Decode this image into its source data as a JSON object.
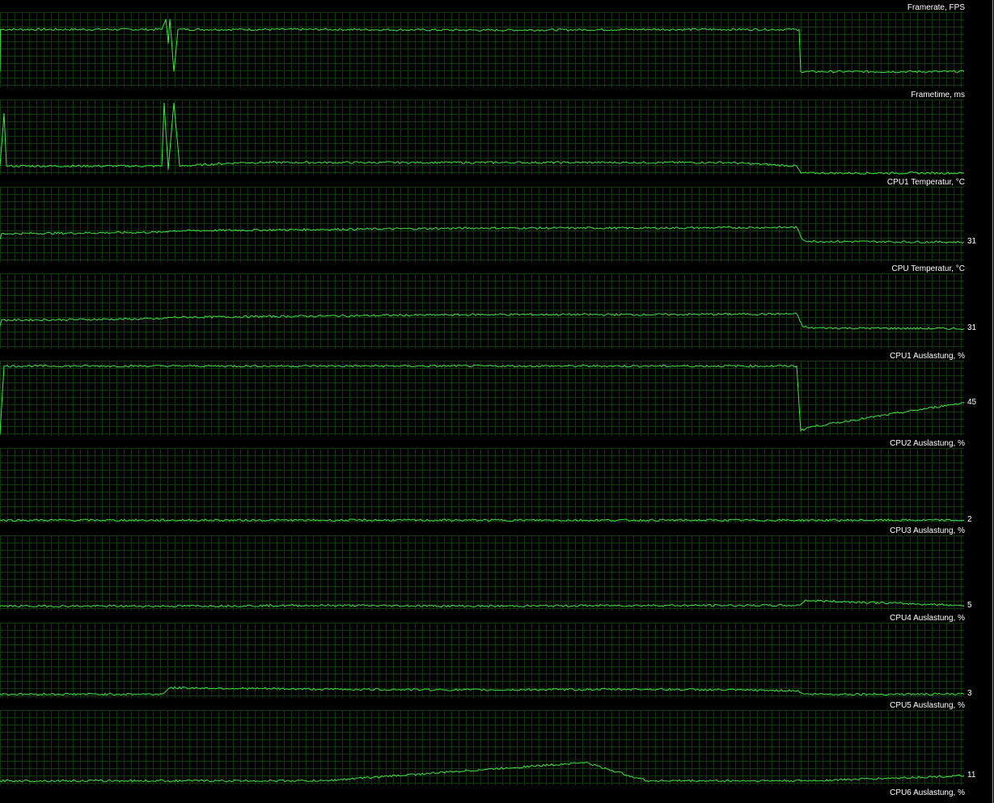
{
  "colors": {
    "background": "#000000",
    "grid": "#0d3a0d",
    "trace": "#3ee83e",
    "text": "#ffffff"
  },
  "chart_data": [
    {
      "type": "line",
      "title": "Framerate, FPS",
      "current_value": "",
      "ylim": [
        0,
        100
      ],
      "series": [
        {
          "points": [
            [
              0,
              20
            ],
            [
              0.5,
              80
            ],
            [
              200,
              80
            ],
            [
              205,
              95
            ],
            [
              208,
              60
            ],
            [
              210,
              95
            ],
            [
              215,
              20
            ],
            [
              220,
              80
            ],
            [
              400,
              80
            ],
            [
              600,
              79
            ],
            [
              800,
              80
            ],
            [
              988,
              80
            ],
            [
              990,
              20
            ],
            [
              1192,
              20
            ]
          ]
        }
      ]
    },
    {
      "type": "line",
      "title": "Frametime, ms",
      "current_value": "",
      "ylim": [
        0,
        100
      ],
      "series": [
        {
          "points": [
            [
              0,
              10
            ],
            [
              5,
              85
            ],
            [
              8,
              10
            ],
            [
              200,
              10
            ],
            [
              203,
              100
            ],
            [
              208,
              5
            ],
            [
              215,
              100
            ],
            [
              222,
              10
            ],
            [
              300,
              15
            ],
            [
              500,
              15
            ],
            [
              700,
              15
            ],
            [
              900,
              15
            ],
            [
              985,
              10
            ],
            [
              990,
              0
            ],
            [
              1192,
              0
            ]
          ]
        }
      ]
    },
    {
      "type": "line",
      "title": "CPU1 Temperatur, °C",
      "current_value": "31",
      "ylim": [
        0,
        100
      ],
      "series": [
        {
          "points": [
            [
              0,
              30
            ],
            [
              2,
              38
            ],
            [
              200,
              40
            ],
            [
              210,
              42
            ],
            [
              400,
              44
            ],
            [
              600,
              46
            ],
            [
              800,
              46
            ],
            [
              985,
              47
            ],
            [
              992,
              30
            ],
            [
              1000,
              27
            ],
            [
              1192,
              26
            ]
          ]
        }
      ]
    },
    {
      "type": "line",
      "title": "CPU Temperatur, °C",
      "current_value": "31",
      "ylim": [
        0,
        100
      ],
      "series": [
        {
          "points": [
            [
              0,
              30
            ],
            [
              2,
              38
            ],
            [
              200,
              40
            ],
            [
              210,
              42
            ],
            [
              400,
              44
            ],
            [
              600,
              46
            ],
            [
              800,
              46
            ],
            [
              985,
              47
            ],
            [
              992,
              30
            ],
            [
              1000,
              27
            ],
            [
              1192,
              26
            ]
          ]
        }
      ]
    },
    {
      "type": "line",
      "title": "CPU1 Auslastung, %",
      "current_value": "45",
      "ylim": [
        0,
        100
      ],
      "series": [
        {
          "points": [
            [
              0,
              0
            ],
            [
              5,
              97
            ],
            [
              220,
              97
            ],
            [
              400,
              97
            ],
            [
              600,
              97
            ],
            [
              800,
              97
            ],
            [
              985,
              97
            ],
            [
              990,
              5
            ],
            [
              1000,
              10
            ],
            [
              1192,
              45
            ]
          ]
        }
      ]
    },
    {
      "type": "line",
      "title": "CPU2 Auslastung, %",
      "current_value": "2",
      "ylim": [
        0,
        100
      ],
      "series": [
        {
          "points": [
            [
              0,
              2
            ],
            [
              400,
              2
            ],
            [
              800,
              2
            ],
            [
              1192,
              2
            ]
          ]
        }
      ]
    },
    {
      "type": "line",
      "title": "CPU3 Auslastung, %",
      "current_value": "5",
      "ylim": [
        0,
        100
      ],
      "series": [
        {
          "points": [
            [
              0,
              4
            ],
            [
              200,
              4
            ],
            [
              400,
              5
            ],
            [
              600,
              4
            ],
            [
              800,
              5
            ],
            [
              988,
              5
            ],
            [
              995,
              12
            ],
            [
              1192,
              5
            ]
          ]
        }
      ]
    },
    {
      "type": "line",
      "title": "CPU4 Auslastung, %",
      "current_value": "3",
      "ylim": [
        0,
        100
      ],
      "series": [
        {
          "points": [
            [
              0,
              3
            ],
            [
              200,
              3
            ],
            [
              210,
              12
            ],
            [
              400,
              10
            ],
            [
              600,
              9
            ],
            [
              800,
              10
            ],
            [
              985,
              8
            ],
            [
              995,
              3
            ],
            [
              1192,
              3
            ]
          ]
        }
      ]
    },
    {
      "type": "line",
      "title": "CPU5 Auslastung, %",
      "current_value": "11",
      "ylim": [
        0,
        100
      ],
      "series": [
        {
          "points": [
            [
              0,
              4
            ],
            [
              400,
              4
            ],
            [
              723,
              30
            ],
            [
              800,
              4
            ],
            [
              1000,
              4
            ],
            [
              1192,
              11
            ]
          ]
        }
      ]
    },
    {
      "type": "line",
      "title": "CPU6 Auslastung, %",
      "current_value": "",
      "ylim": [
        0,
        100
      ],
      "series": []
    }
  ]
}
